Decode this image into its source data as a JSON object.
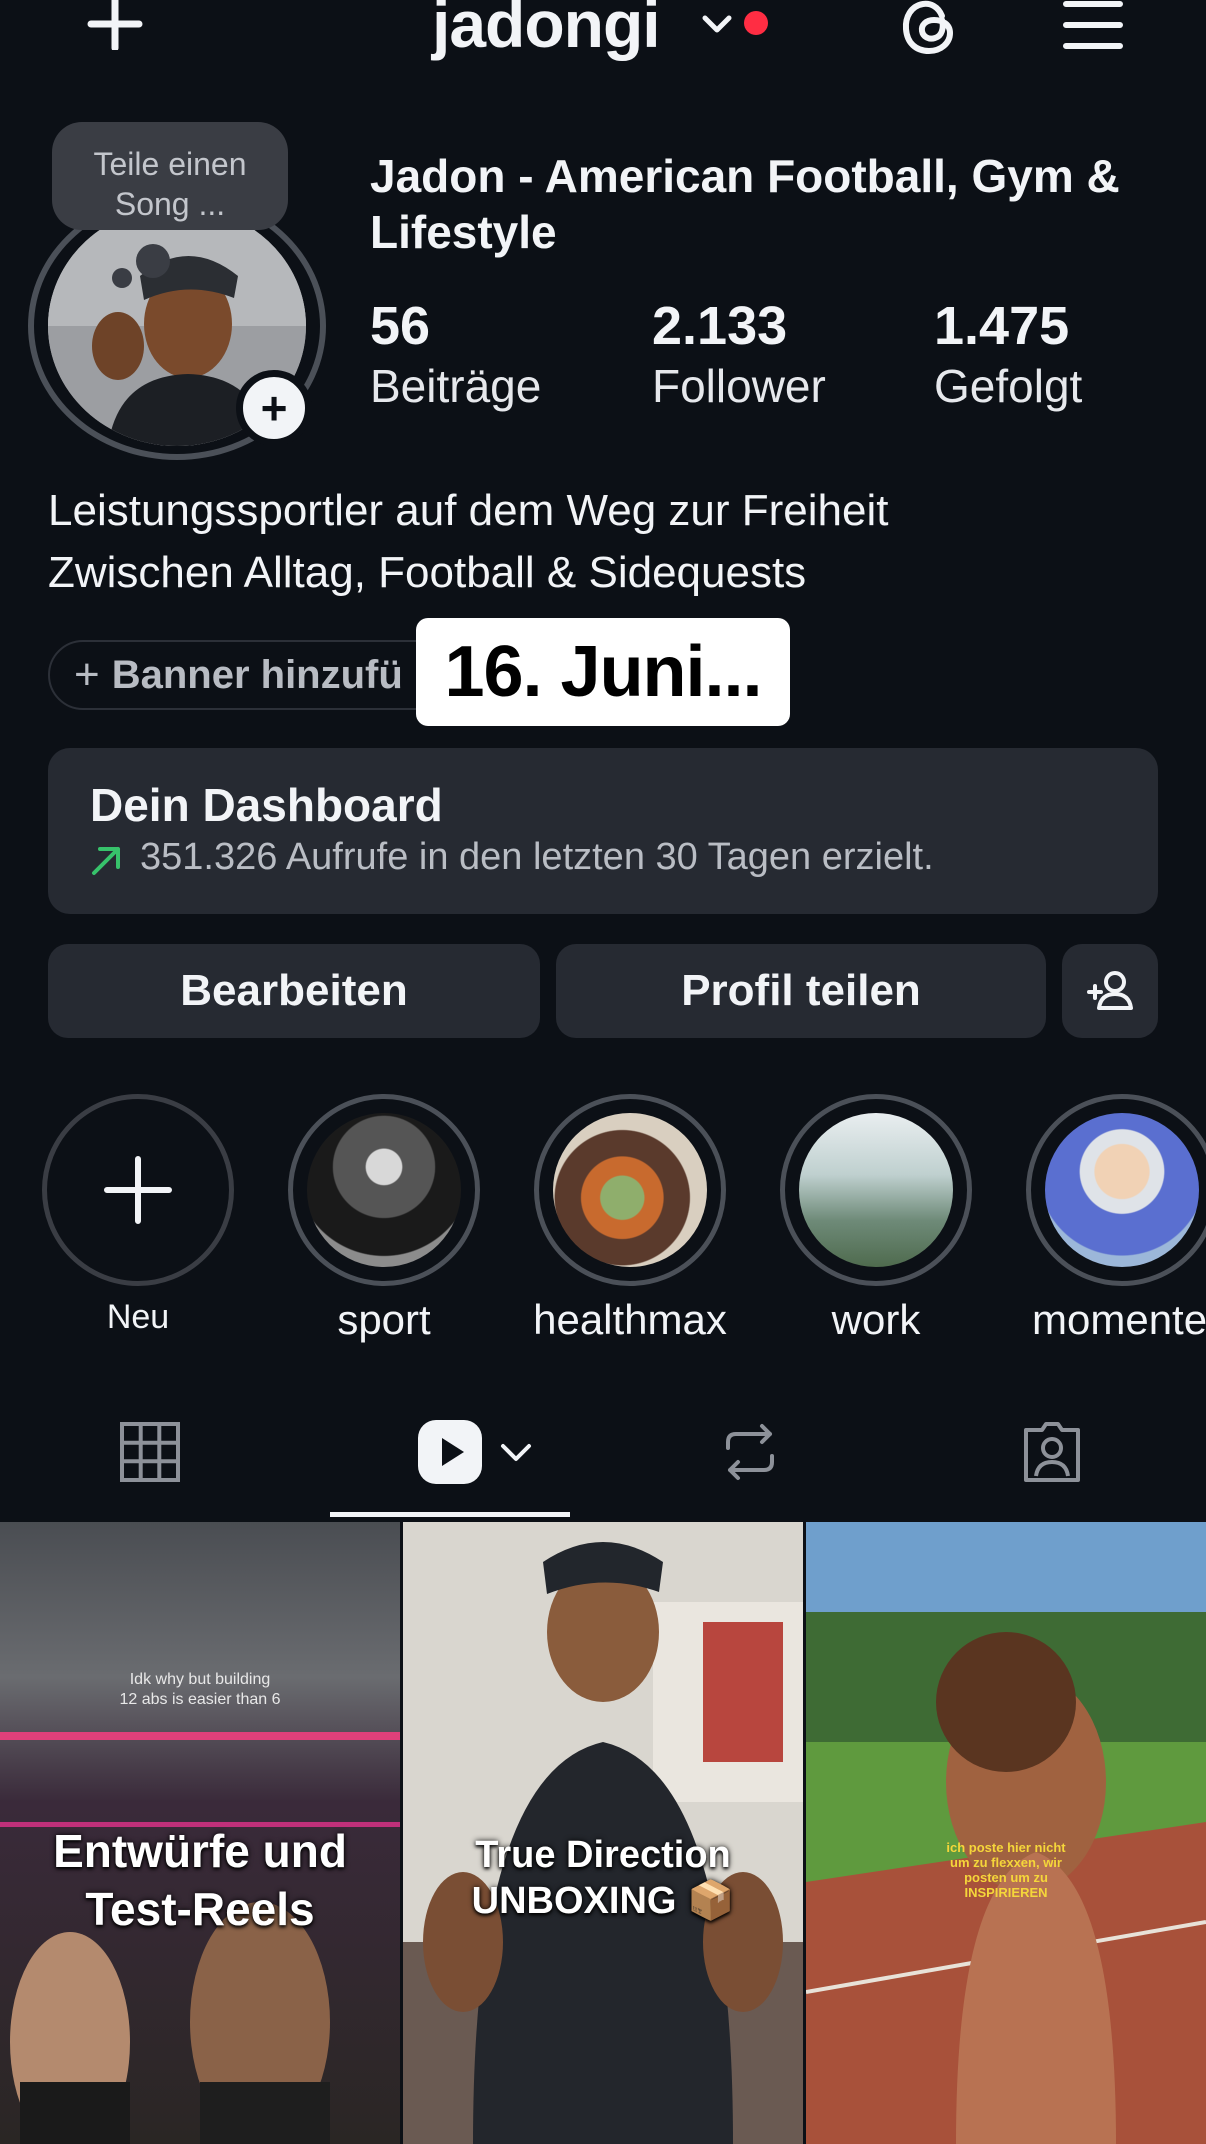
{
  "header": {
    "username": "jadongi",
    "icons": [
      "plus-icon",
      "chevron-down-icon",
      "threads-icon",
      "menu-icon"
    ],
    "notification_color": "#ff2d43"
  },
  "profile": {
    "song_prompt_line1": "Teile einen",
    "song_prompt_line2": "Song ...",
    "display_name": "Jadon - American Football, Gym & Lifestyle",
    "stats": [
      {
        "value": "56",
        "label": "Beiträge"
      },
      {
        "value": "2.133",
        "label": "Follower"
      },
      {
        "value": "1.475",
        "label": "Gefolgt"
      }
    ],
    "bio_line1": "Leistungssportler auf dem Weg zur Freiheit",
    "bio_line2": "Zwischen Alltag, Football & Sidequests",
    "banner_label": "Banner hinzufü",
    "date_sticker": "16. Juni..."
  },
  "dashboard": {
    "title": "Dein Dashboard",
    "subtitle": "351.326 Aufrufe in den letzten 30 Tagen erzielt.",
    "trend_color": "#37c26b"
  },
  "actions": {
    "edit": "Bearbeiten",
    "share": "Profil teilen"
  },
  "highlights": [
    {
      "label": "Neu"
    },
    {
      "label": "sport"
    },
    {
      "label": "healthmax"
    },
    {
      "label": "work"
    },
    {
      "label": "momente"
    }
  ],
  "tabs": [
    "grid-icon",
    "reels-icon",
    "reposts-icon",
    "tagged-icon"
  ],
  "grid": [
    {
      "small_text_line1": "Idk why but building",
      "small_text_line2": "12 abs is easier than 6",
      "caption_line1": "Entwürfe und",
      "caption_line2": "Test-Reels"
    },
    {
      "caption_line1": "True Direction",
      "caption_line2": "UNBOXING 📦"
    },
    {
      "small_text_line1": "ich poste hier nicht",
      "small_text_line2": "um zu flexxen, wir",
      "small_text_line3": "posten um zu",
      "small_text_line4": "INSPIRIEREN"
    }
  ]
}
